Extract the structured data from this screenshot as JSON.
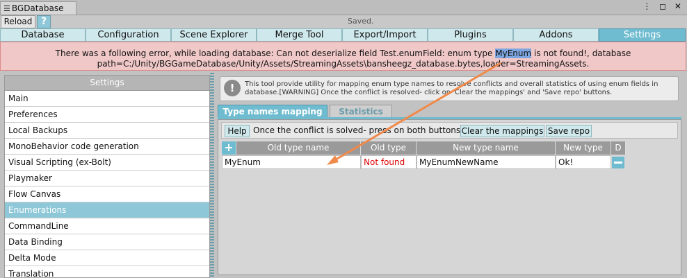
{
  "window": {
    "title": "BGDatabase",
    "controls": "⋮ ◻ ✕"
  },
  "toolbar": {
    "reload": "Reload",
    "help": "?",
    "status": "Saved."
  },
  "tabs": [
    "Database",
    "Configuration",
    "Scene Explorer",
    "Merge Tool",
    "Export/Import",
    "Plugins",
    "Addons",
    "Settings"
  ],
  "error": {
    "before": "There was a following error, while loading database: Can not deserialize field Test.enumField: enum type ",
    "highlight": "MyEnum",
    "after": " is not found!, database",
    "line2": "path=C:/Unity/BGGameDatabase/Unity/Assets/StreamingAssets\\bansheegz_database.bytes,loader=StreamingAssets."
  },
  "settings": {
    "header": "Settings",
    "items": [
      "Main",
      "Preferences",
      "Local Backups",
      "MonoBehavior code generation",
      "Visual Scripting (ex-Bolt)",
      "Playmaker",
      "Flow Canvas",
      "Enumerations",
      "CommandLine",
      "Data Binding",
      "Delta Mode",
      "Translation"
    ],
    "selected": "Enumerations"
  },
  "info": {
    "line1": "This tool provide utility for mapping enum type names to resolve conflicts and overall statistics of using enum fields in",
    "line2": "database.[WARNING] Once the conflict is resolved- click on 'Clear the mappings' and 'Save repo' buttons."
  },
  "subtabs": {
    "active": "Type names mapping",
    "inactive": "Statistics"
  },
  "actions": {
    "help": "Help",
    "text": "Once the conflict is solved- press on both buttons->",
    "clear": "Clear the mappings",
    "save": "Save repo"
  },
  "grid": {
    "headers": {
      "old_name": "Old type name",
      "old_type": "Old type",
      "new_name": "New type name",
      "new_type": "New type",
      "d": "D"
    },
    "row": {
      "old_name": "MyEnum",
      "old_type": "Not found",
      "new_name": "MyEnumNewName",
      "new_type": "Ok!"
    }
  },
  "colors": {
    "accent": "#6fbcd0",
    "error_bg": "#f0c8c8",
    "not_found": "#e00000",
    "arrow": "#f08a4b"
  }
}
